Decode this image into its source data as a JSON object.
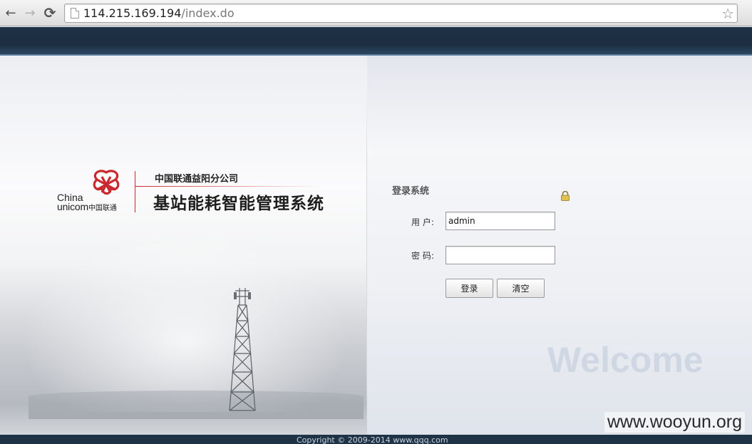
{
  "browser": {
    "url_host": "114.215.169.194",
    "url_path": "/index.do",
    "back_icon": "←",
    "forward_icon": "→",
    "reload_icon": "⟳",
    "star_icon": "☆"
  },
  "brand": {
    "logo_en_line1": "China",
    "logo_en_line2": "unicom",
    "logo_cn": "中国联通",
    "company": "中国联通益阳分公司",
    "system_title": "基站能耗智能管理系统",
    "accent_color": "#c8282e"
  },
  "login": {
    "title": "登录系统",
    "username_label": "用 户:",
    "username_value": "admin",
    "password_label": "密 码:",
    "password_value": "",
    "login_button": "登录",
    "clear_button": "清空"
  },
  "welcome_text": "Welcome",
  "footer": {
    "copyright": "Copyright © 2009-2014 www.qqq.com"
  },
  "watermark": "www.wooyun.org"
}
